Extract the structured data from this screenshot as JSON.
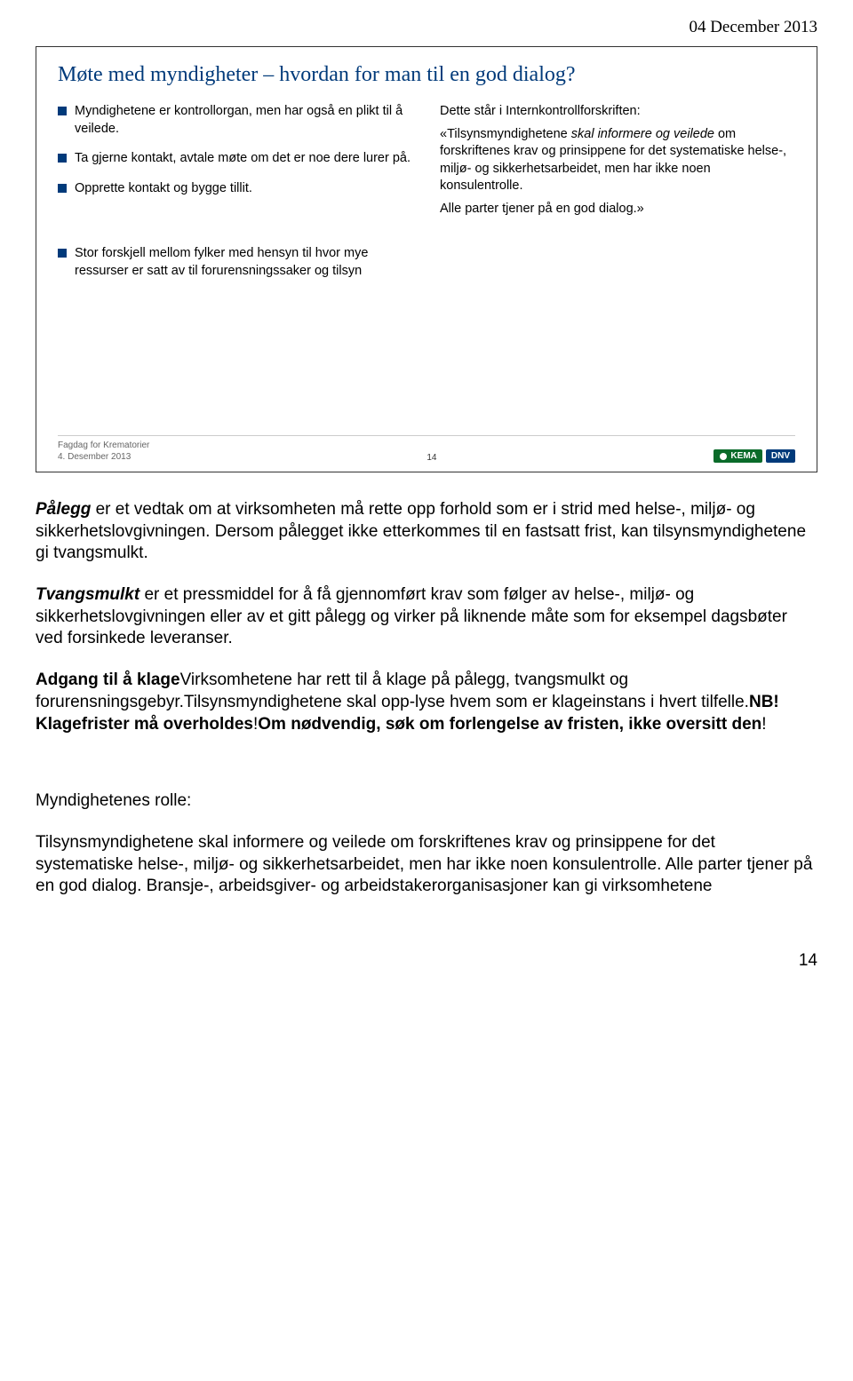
{
  "header_date": "04 December 2013",
  "slide": {
    "title": "Møte med myndigheter – hvordan for man til en god dialog?",
    "left_bullets": [
      "Myndighetene er kontrollorgan, men har også en plikt til å veilede.",
      "Ta gjerne kontakt, avtale møte om det er noe dere lurer på.",
      "Opprette kontakt og bygge tillit.",
      "Stor forskjell mellom fylker med hensyn til hvor mye ressurser er satt av til forurensningssaker og tilsyn"
    ],
    "right": {
      "intro": "Dette står i Internkontrollforskriften:",
      "quote_lead": "«Tilsynsmyndighetene ",
      "quote_italic": "skal informere og veilede",
      "quote_tail": " om forskriftenes krav og prinsippene for det systematiske helse-, miljø- og sikkerhetsarbeidet, men har ikke noen konsulentrolle.",
      "line2": "Alle parter tjener på en god dialog.»"
    },
    "footer": {
      "line1": "Fagdag for Krematorier",
      "line2": "4. Desember 2013",
      "page": "14",
      "kema": "KEMA",
      "dnv": "DNV"
    }
  },
  "body": {
    "p1_leadbold": "Pålegg",
    "p1_rest": " er et vedtak om at virksomheten må rette opp forhold som er i strid med helse-, miljø- og sikkerhetslovgivningen. Dersom pålegget ikke etterkommes til en fastsatt frist, kan tilsynsmyndighetene gi tvangsmulkt.",
    "p2_leadbold": "Tvangsmulkt",
    "p2_rest": " er et pressmiddel for å få gjennomført krav som følger av helse-, miljø- og sikkerhetslovgivningen eller av et gitt pålegg og virker på liknende måte som for eksempel dagsbøter ved forsinkede leveranser.",
    "p3_b1": "Adgang til å klage",
    "p3_t1": "Virksomhetene har rett til å klage på pålegg, tvangsmulkt og forurensningsgebyr.Tilsynsmyndighetene skal opp-lyse hvem som er klageinstans i hvert tilfelle.",
    "p3_b2": "NB! Klagefrister må overholdes",
    "p3_t2": "!",
    "p3_b3": "Om nødvendig, søk om forlengelse av fristen, ikke oversitt den",
    "p3_t3": "!",
    "p4_lead": "Myndighetenes rolle:",
    "p5": "Tilsynsmyndighetene skal informere og veilede om forskriftenes krav og prinsippene for det systematiske helse-, miljø- og sikkerhetsarbeidet, men har ikke noen konsulentrolle. Alle parter tjener på en god dialog. Bransje-, arbeidsgiver- og arbeidstakerorganisasjoner kan gi virksomhetene"
  },
  "page_number": "14"
}
